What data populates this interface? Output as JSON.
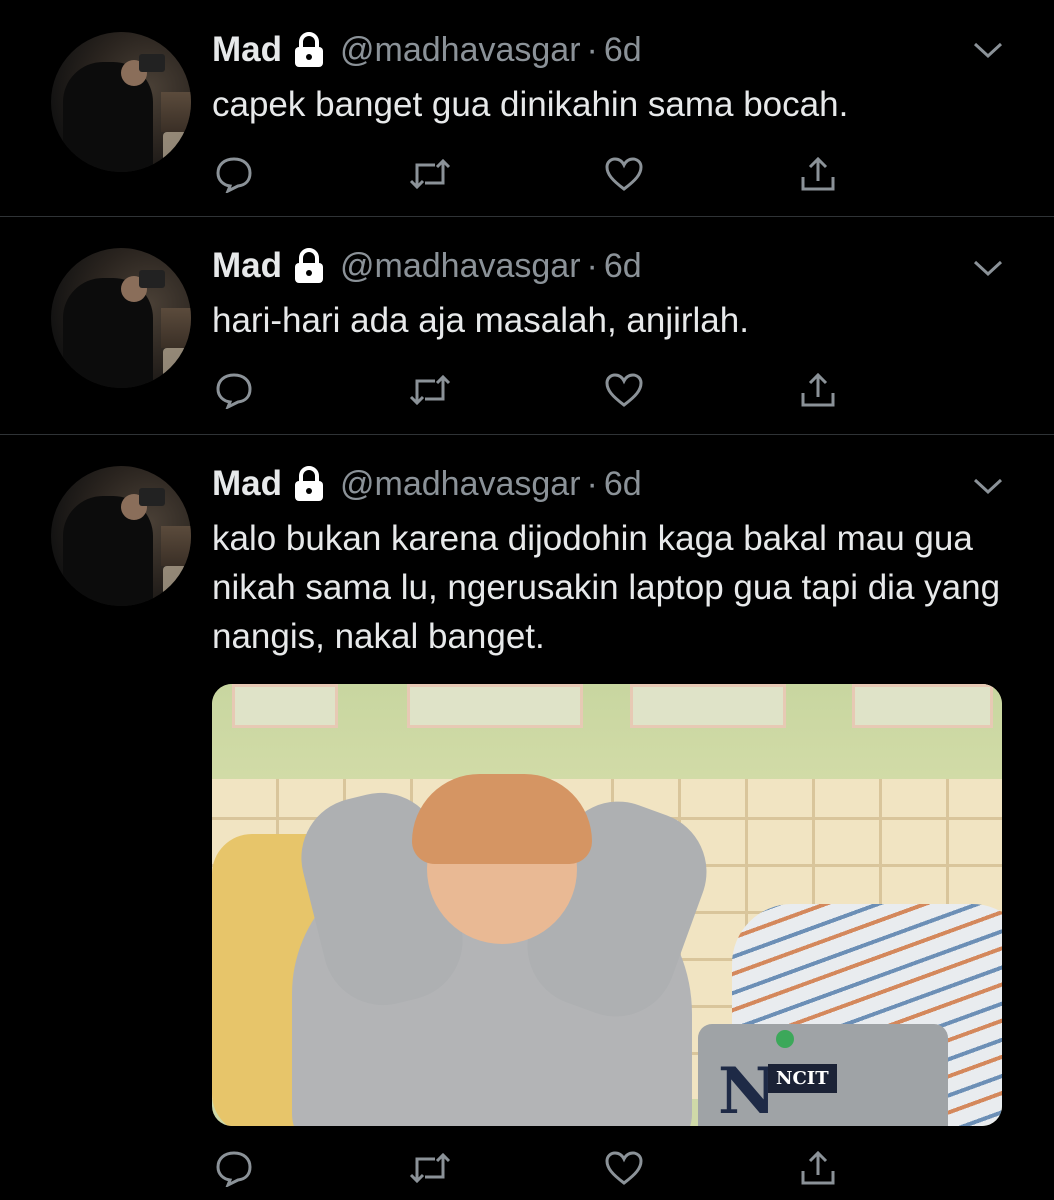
{
  "colors": {
    "background": "#000000",
    "text": "#e7e9ea",
    "muted": "#8b9298",
    "divider": "#2f3336"
  },
  "tweets": [
    {
      "name": "Mad",
      "handle": "@madhavasgar",
      "separator": "·",
      "time": "6d",
      "text": "capek banget gua dinikahin sama bocah."
    },
    {
      "name": "Mad",
      "handle": "@madhavasgar",
      "separator": "·",
      "time": "6d",
      "text": "hari-hari ada aja masalah, anjirlah."
    },
    {
      "name": "Mad",
      "handle": "@madhavasgar",
      "separator": "·",
      "time": "6d",
      "text": "kalo bukan karena dijodohin kaga bakal mau gua nikah sama lu, ngerusakin laptop gua tapi dia yang nangis, nakal banget.",
      "media": {
        "laptop_letter": "N",
        "laptop_sticker": "NCIT"
      }
    }
  ],
  "icons": [
    "reply-icon",
    "retweet-icon",
    "like-icon",
    "share-icon",
    "lock-icon",
    "chevron-down-icon"
  ]
}
